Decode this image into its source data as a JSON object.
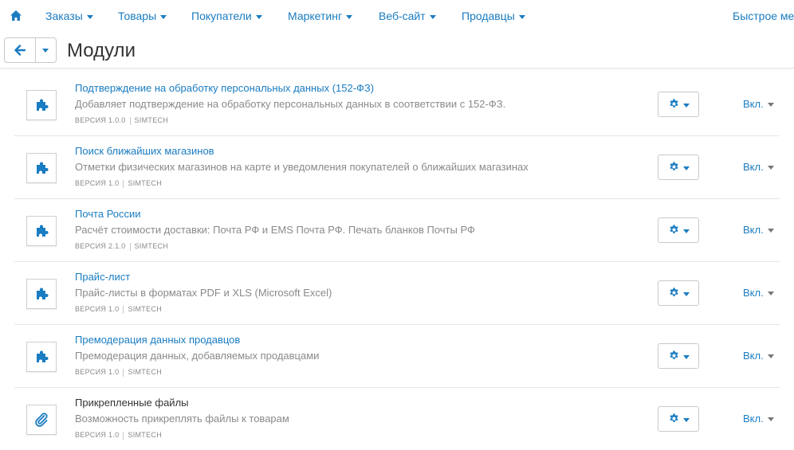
{
  "nav": {
    "home_icon": "home-icon",
    "items": [
      {
        "label": "Заказы"
      },
      {
        "label": "Товары"
      },
      {
        "label": "Покупатели"
      },
      {
        "label": "Маркетинг"
      },
      {
        "label": "Веб-сайт"
      },
      {
        "label": "Продавцы"
      }
    ],
    "quick_menu": "Быстрое мен"
  },
  "toolbar": {
    "back_icon": "arrow-left-icon",
    "title": "Модули"
  },
  "colors": {
    "link": "#1a7cc1",
    "muted": "#8a8a8a",
    "border": "#e6e6e6"
  },
  "modules": [
    {
      "title": "Подтверждение на обработку персональных данных (152-ФЗ)",
      "description": "Добавляет подтверждение на обработку персональных данных в соответствии с 152-ФЗ.",
      "version": "ВЕРСИЯ 1.0.0",
      "vendor": "SIMTECH",
      "status": "Вкл.",
      "icon": "puzzle-icon"
    },
    {
      "title": "Поиск ближайших магазинов",
      "description": "Отметки физических магазинов на карте и уведомления покупателей о ближайших магазинах",
      "version": "ВЕРСИЯ 1.0",
      "vendor": "SIMTECH",
      "status": "Вкл.",
      "icon": "puzzle-icon"
    },
    {
      "title": "Почта России",
      "description": "Расчёт стоимости доставки: Почта РФ и EMS Почта РФ. Печать бланков Почты РФ",
      "version": "ВЕРСИЯ 2.1.0",
      "vendor": "SIMTECH",
      "status": "Вкл.",
      "icon": "puzzle-icon"
    },
    {
      "title": "Прайс-лист",
      "description": "Прайс-листы в форматах PDF и XLS (Microsoft Excel)",
      "version": "ВЕРСИЯ 1.0",
      "vendor": "SIMTECH",
      "status": "Вкл.",
      "icon": "puzzle-icon"
    },
    {
      "title": "Премодерация данных продавцов",
      "description": "Премодерация данных, добавляемых продавцами",
      "version": "ВЕРСИЯ 1.0",
      "vendor": "SIMTECH",
      "status": "Вкл.",
      "icon": "puzzle-icon"
    },
    {
      "title": "Прикрепленные файлы",
      "description": "Возможность прикреплять файлы к товарам",
      "version": "ВЕРСИЯ 1.0",
      "vendor": "SIMTECH",
      "status": "Вкл.",
      "icon": "paperclip-icon"
    }
  ]
}
